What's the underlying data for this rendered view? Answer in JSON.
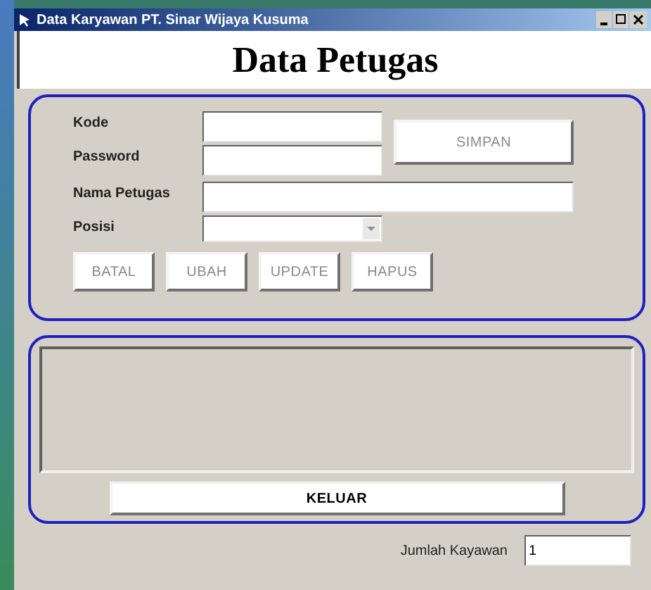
{
  "window": {
    "title": "Data Karyawan PT. Sinar Wijaya Kusuma"
  },
  "heading": "Data Petugas",
  "form": {
    "fields": [
      {
        "label": "Kode",
        "kind": "text"
      },
      {
        "label": "Password",
        "kind": "text"
      },
      {
        "label": "Nama Petugas",
        "kind": "wide"
      },
      {
        "label": "Posisi",
        "kind": "combo"
      }
    ],
    "save_button": {
      "label": "SIMPAN",
      "disabled": true
    },
    "buttons": [
      {
        "label": "BATAL",
        "disabled": true
      },
      {
        "label": "UBAH",
        "disabled": true
      },
      {
        "label": "UPDATE",
        "disabled": true
      },
      {
        "label": "HAPUS",
        "disabled": true
      }
    ]
  },
  "exit_button": {
    "label": "KELUAR",
    "disabled": false
  },
  "footer": {
    "label": "Jumlah Kayawan",
    "value": "1"
  }
}
